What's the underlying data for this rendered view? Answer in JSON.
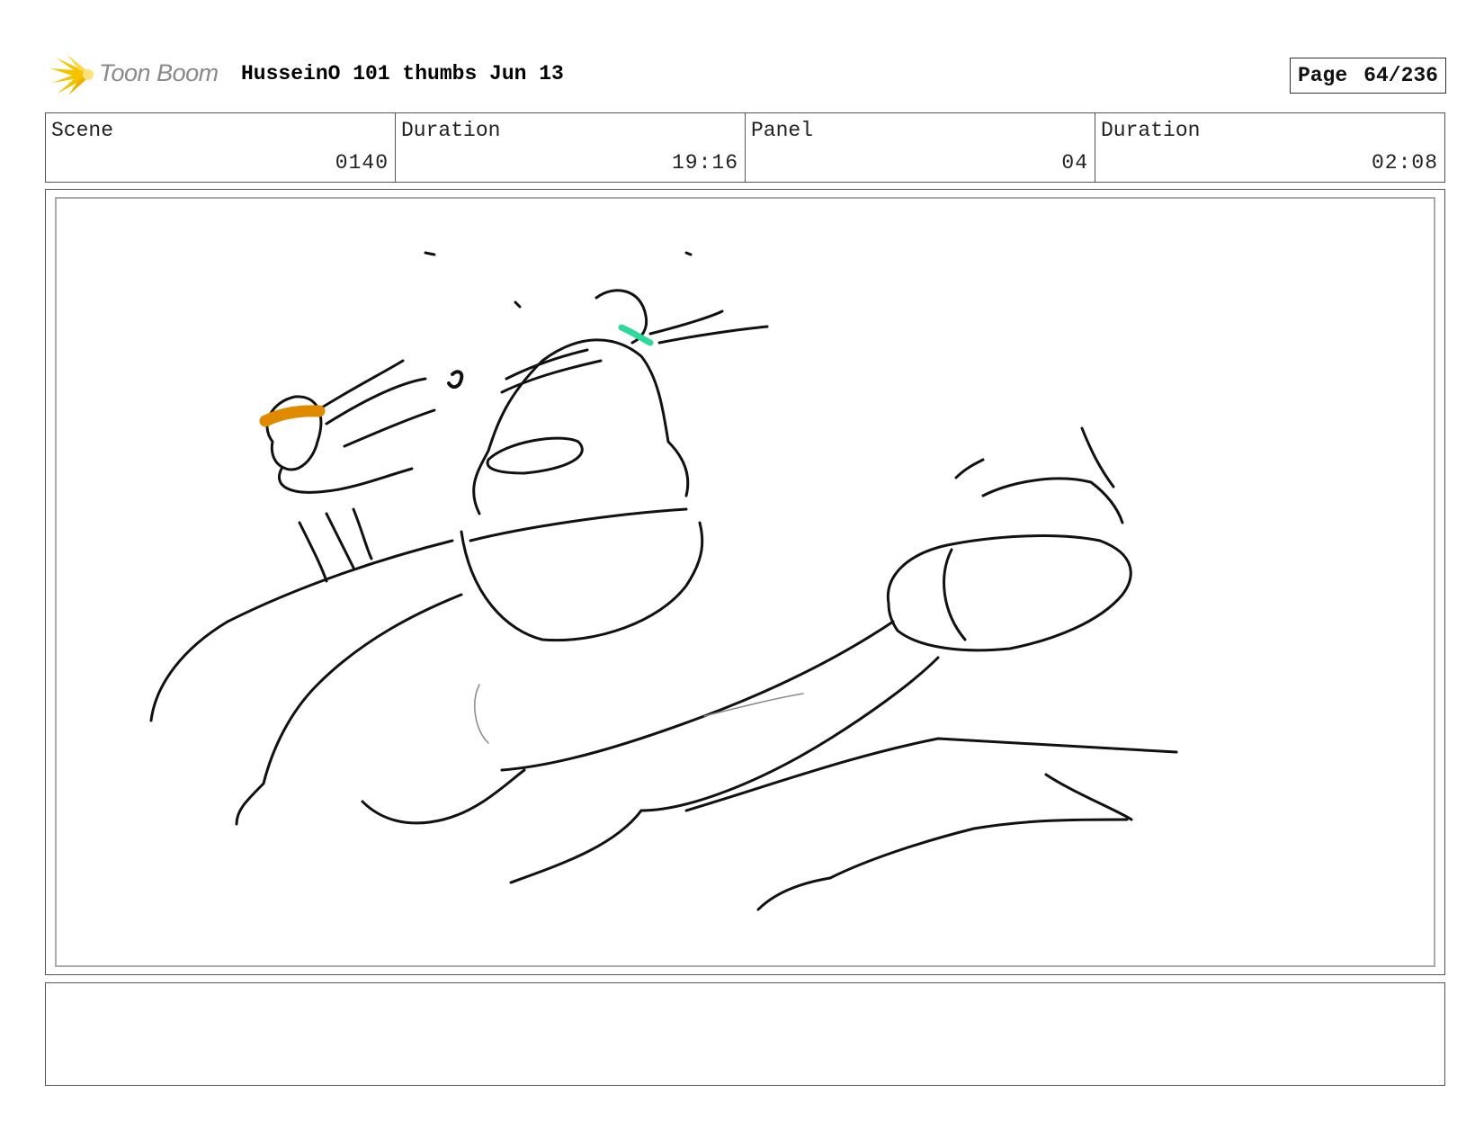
{
  "header": {
    "logo_text": "Toon Boom",
    "project_title": "HusseinO 101 thumbs Jun 13",
    "page_label": "Page",
    "page_number": "64/236"
  },
  "info": {
    "scene_label": "Scene",
    "scene_value": "0140",
    "scene_duration_label": "Duration",
    "scene_duration_value": "19:16",
    "panel_label": "Panel",
    "panel_value": "04",
    "panel_duration_label": "Duration",
    "panel_duration_value": "02:08"
  },
  "panel": {
    "sketch_icon": "character-sketch",
    "accent_colors": {
      "orange": "#e08a00",
      "green": "#2fd99a"
    }
  },
  "notes": {
    "text": ""
  },
  "colors": {
    "logo_yellow": "#f5c400",
    "border": "#555555"
  }
}
